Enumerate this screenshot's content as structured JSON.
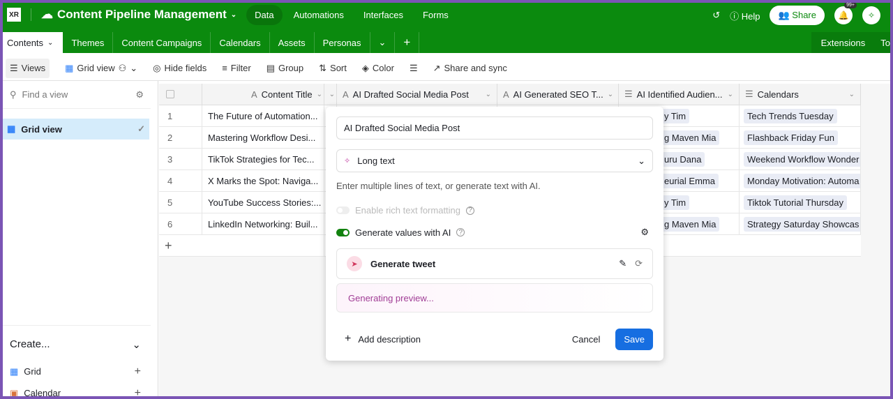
{
  "app": {
    "logo": "XR",
    "title": "Content Pipeline Management",
    "nav": [
      "Data",
      "Automations",
      "Interfaces",
      "Forms"
    ],
    "help": "Help",
    "share": "Share",
    "notif_badge": "99+",
    "accent": "#0b8a0e"
  },
  "tabs": {
    "active": "Contents",
    "items": [
      "Themes",
      "Content Campaigns",
      "Calendars",
      "Assets",
      "Personas"
    ],
    "right": [
      "Extensions",
      "To"
    ]
  },
  "toolbar": {
    "views": "Views",
    "grid_view": "Grid view",
    "hide_fields": "Hide fields",
    "filter": "Filter",
    "group": "Group",
    "sort": "Sort",
    "color": "Color",
    "share_sync": "Share and sync"
  },
  "sidebar": {
    "find_placeholder": "Find a view",
    "active_view": "Grid view",
    "create": "Create...",
    "create_items": [
      "Grid",
      "Calendar"
    ]
  },
  "grid": {
    "columns": [
      "Content Title",
      "AI Drafted Social Media Post",
      "AI Generated SEO T...",
      "AI Identified Audien...",
      "Calendars"
    ],
    "rows": [
      {
        "n": "1",
        "title": "The Future of Automation...",
        "aud": "y Tim",
        "cal": "Tech Trends Tuesday"
      },
      {
        "n": "2",
        "title": "Mastering Workflow Desi...",
        "aud": "g Maven Mia",
        "cal": "Flashback Friday Fun"
      },
      {
        "n": "3",
        "title": "TikTok Strategies for Tec...",
        "aud": "uru Dana",
        "cal": "Weekend Workflow Wonder"
      },
      {
        "n": "4",
        "title": "X Marks the Spot: Naviga...",
        "aud": "eurial Emma",
        "cal": "Monday Motivation: Automa"
      },
      {
        "n": "5",
        "title": "YouTube Success Stories:...",
        "aud": "y Tim",
        "cal": "Tiktok Tutorial Thursday"
      },
      {
        "n": "6",
        "title": "LinkedIn Networking: Buil...",
        "aud": "g Maven Mia",
        "cal": "Strategy Saturday Showcas"
      }
    ]
  },
  "modal": {
    "field_name": "AI Drafted Social Media Post",
    "field_type": "Long text",
    "description": "Enter multiple lines of text, or generate text with AI.",
    "rich_text": "Enable rich text formatting",
    "rich_text_on": false,
    "generate_ai": "Generate values with AI",
    "generate_ai_on": true,
    "prompt": "Generate tweet",
    "preview": "Generating preview...",
    "add_description": "Add description",
    "cancel": "Cancel",
    "save": "Save"
  }
}
